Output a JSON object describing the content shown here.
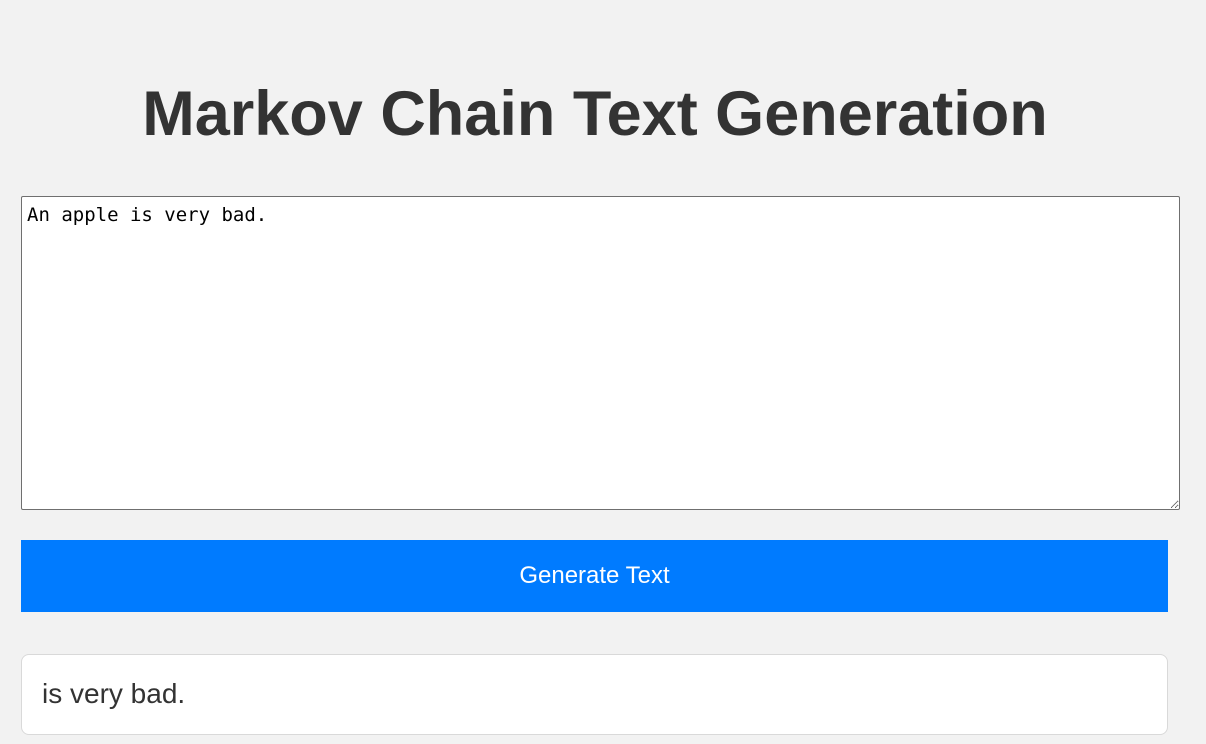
{
  "page": {
    "title": "Markov Chain Text Generation"
  },
  "input": {
    "value": "An apple is very bad."
  },
  "actions": {
    "generate_label": "Generate Text"
  },
  "output": {
    "text": "is very bad."
  },
  "colors": {
    "background": "#f2f2f2",
    "title_text": "#333333",
    "button_bg": "#007bff",
    "button_text": "#ffffff",
    "output_bg": "#ffffff"
  }
}
